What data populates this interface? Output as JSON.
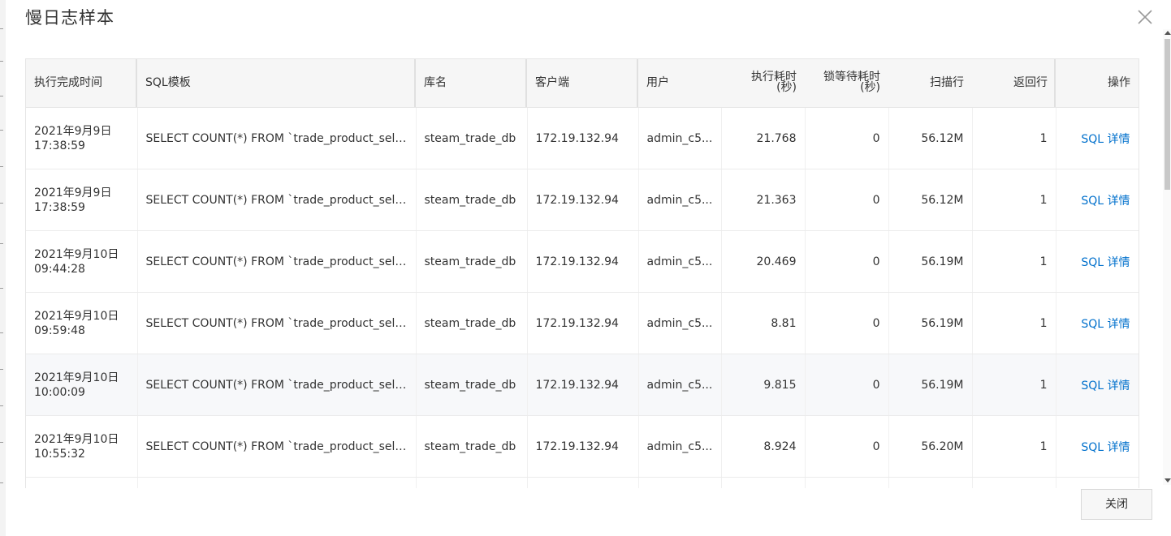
{
  "dialog": {
    "title": "慢日志样本",
    "close_button_label": "关闭"
  },
  "table": {
    "headers": {
      "time": "执行完成时间",
      "sql": "SQL模板",
      "db": "库名",
      "client": "客户端",
      "user": "用户",
      "exec_time_1": "执行耗时",
      "exec_time_2": "(秒)",
      "lock_time_1": "锁等待耗时",
      "lock_time_2": "(秒)",
      "rows_scanned": "扫描行",
      "rows_returned": "返回行",
      "action": "操作"
    },
    "rows": [
      {
        "date": "2021年9月9日",
        "time": "17:38:59",
        "sql": "SELECT COUNT(*) FROM `trade_product_sell` WHERE status = ?",
        "db": "steam_trade_db",
        "client": "172.19.132.94",
        "user": "admin_c5...",
        "exec": "21.768",
        "lock": "0",
        "scanned": "56.12M",
        "returned": "1",
        "action": "SQL 详情"
      },
      {
        "date": "2021年9月9日",
        "time": "17:38:59",
        "sql": "SELECT COUNT(*) FROM `trade_product_sell` WHERE status = ?",
        "db": "steam_trade_db",
        "client": "172.19.132.94",
        "user": "admin_c5...",
        "exec": "21.363",
        "lock": "0",
        "scanned": "56.12M",
        "returned": "1",
        "action": "SQL 详情"
      },
      {
        "date": "2021年9月10日",
        "time": "09:44:28",
        "sql": "SELECT COUNT(*) FROM `trade_product_sell` WHERE status = ?",
        "db": "steam_trade_db",
        "client": "172.19.132.94",
        "user": "admin_c5...",
        "exec": "20.469",
        "lock": "0",
        "scanned": "56.19M",
        "returned": "1",
        "action": "SQL 详情"
      },
      {
        "date": "2021年9月10日",
        "time": "09:59:48",
        "sql": "SELECT COUNT(*) FROM `trade_product_sell` WHERE status = ?",
        "db": "steam_trade_db",
        "client": "172.19.132.94",
        "user": "admin_c5...",
        "exec": "8.81",
        "lock": "0",
        "scanned": "56.19M",
        "returned": "1",
        "action": "SQL 详情"
      },
      {
        "date": "2021年9月10日",
        "time": "10:00:09",
        "sql": "SELECT COUNT(*) FROM `trade_product_sell` WHERE status = ?",
        "db": "steam_trade_db",
        "client": "172.19.132.94",
        "user": "admin_c5...",
        "exec": "9.815",
        "lock": "0",
        "scanned": "56.19M",
        "returned": "1",
        "action": "SQL 详情"
      },
      {
        "date": "2021年9月10日",
        "time": "10:55:32",
        "sql": "SELECT COUNT(*) FROM `trade_product_sell` WHERE status = ?",
        "db": "steam_trade_db",
        "client": "172.19.132.94",
        "user": "admin_c5...",
        "exec": "8.924",
        "lock": "0",
        "scanned": "56.20M",
        "returned": "1",
        "action": "SQL 详情"
      },
      {
        "date": "",
        "time": "",
        "sql": "",
        "db": "",
        "client": "",
        "user": "",
        "exec": "",
        "lock": "",
        "scanned": "",
        "returned": "",
        "action": ""
      }
    ],
    "highlighted_row": 4
  },
  "colors": {
    "link": "#0070cc",
    "header_bg": "#f6f6f6",
    "row_highlight": "#f7f8fa"
  }
}
